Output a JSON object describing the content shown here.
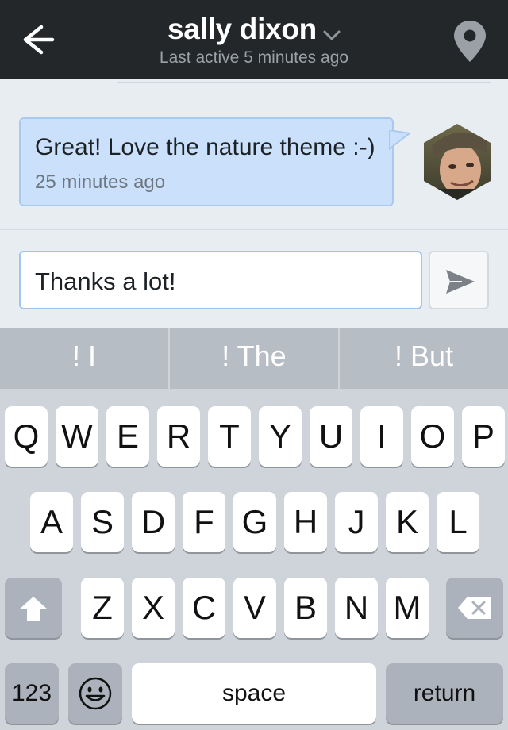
{
  "header": {
    "title": "sally dixon",
    "subtitle": "Last active 5 minutes ago",
    "back_icon": "back-arrow-icon",
    "title_icon": "chevron-down-icon",
    "location_icon": "location-pin-icon",
    "background": "#23272a"
  },
  "conversation": {
    "messages": [
      {
        "text": "Great! Love the nature theme :-)",
        "time": "25 minutes ago"
      }
    ],
    "bubble_color": "#cbe1fb"
  },
  "compose": {
    "input_value": "Thanks a lot!",
    "send_icon": "send-icon"
  },
  "keyboard": {
    "suggestions": [
      "! I",
      "! The",
      "! But"
    ],
    "row1": [
      "Q",
      "W",
      "E",
      "R",
      "T",
      "Y",
      "U",
      "I",
      "O",
      "P"
    ],
    "row2": [
      "A",
      "S",
      "D",
      "F",
      "G",
      "H",
      "J",
      "K",
      "L"
    ],
    "row3": [
      "Z",
      "X",
      "C",
      "V",
      "B",
      "N",
      "M"
    ],
    "shift_icon": "shift-arrow-icon",
    "delete_icon": "backspace-icon",
    "numbers_label": "123",
    "emoji_icon": "emoji-smiley-icon",
    "space_label": "space",
    "return_label": "return"
  }
}
